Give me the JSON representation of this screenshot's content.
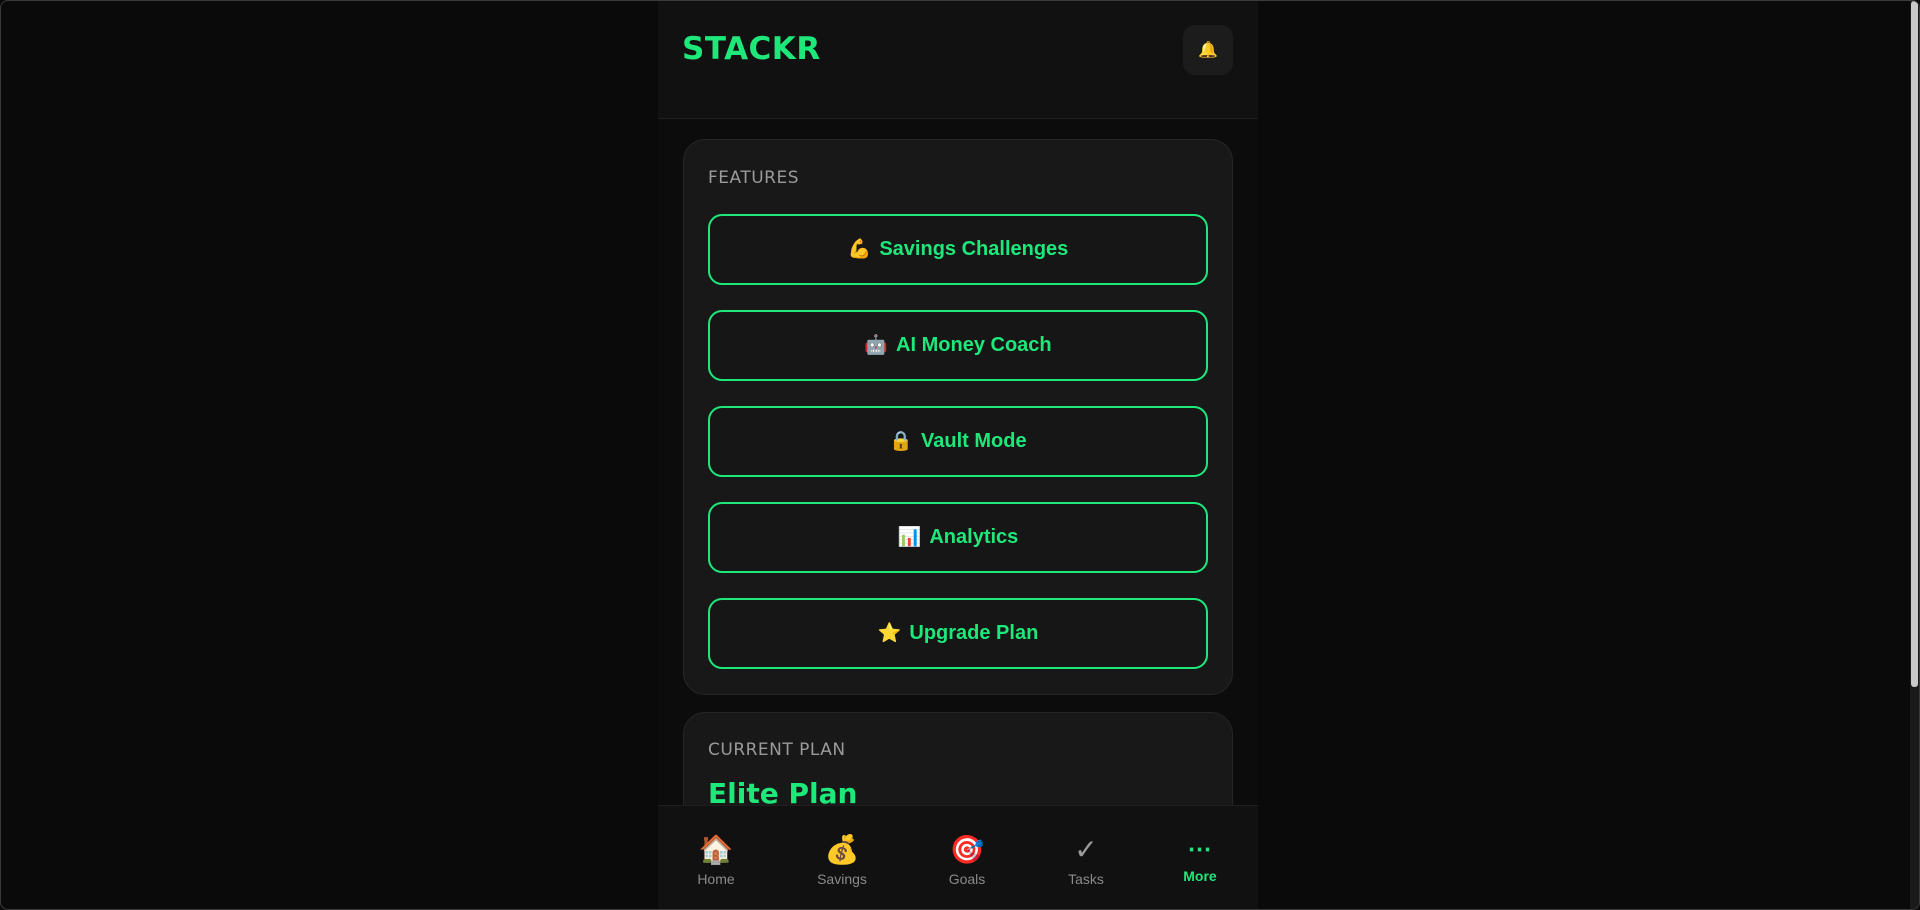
{
  "header": {
    "logo": "STACKR",
    "notification_icon": "🔔"
  },
  "features": {
    "section_label": "FEATURES",
    "items": [
      {
        "icon": "💪",
        "label": "Savings Challenges"
      },
      {
        "icon": "🤖",
        "label": "AI Money Coach"
      },
      {
        "icon": "🔒",
        "label": "Vault Mode"
      },
      {
        "icon": "📊",
        "label": "Analytics"
      },
      {
        "icon": "⭐",
        "label": "Upgrade Plan"
      }
    ]
  },
  "current_plan": {
    "section_label": "CURRENT PLAN",
    "plan_name": "Elite Plan"
  },
  "bottom_nav": {
    "items": [
      {
        "icon": "🏠",
        "label": "Home",
        "active": false
      },
      {
        "icon": "💰",
        "label": "Savings",
        "active": false
      },
      {
        "icon": "🎯",
        "label": "Goals",
        "active": false
      },
      {
        "icon": "✓",
        "label": "Tasks",
        "active": false
      },
      {
        "icon": "⋯",
        "label": "More",
        "active": true
      }
    ]
  },
  "colors": {
    "accent": "#1ee87a",
    "background": "#0a0a0a",
    "card": "#181818",
    "muted_text": "#9a9a9a"
  }
}
